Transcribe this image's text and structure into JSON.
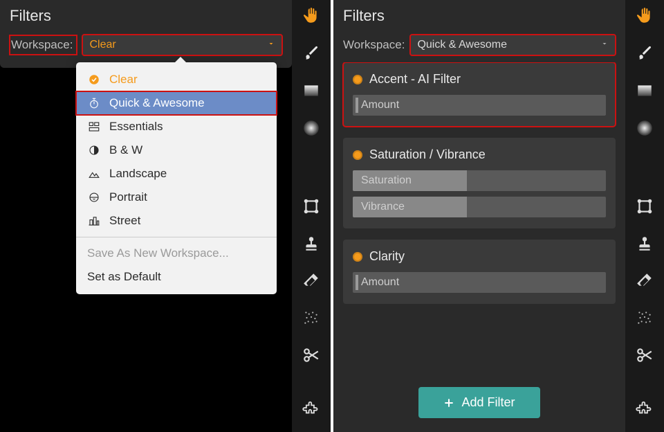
{
  "left": {
    "title": "Filters",
    "workspace_label": "Workspace:",
    "selected_workspace": "Clear",
    "dropdown": {
      "items": [
        {
          "label": "Clear"
        },
        {
          "label": "Quick & Awesome"
        },
        {
          "label": "Essentials"
        },
        {
          "label": "B & W"
        },
        {
          "label": "Landscape"
        },
        {
          "label": "Portrait"
        },
        {
          "label": "Street"
        }
      ],
      "save": "Save As New Workspace...",
      "set_default": "Set as Default"
    }
  },
  "right": {
    "title": "Filters",
    "workspace_label": "Workspace:",
    "selected_workspace": "Quick & Awesome",
    "filters": [
      {
        "name": "Accent - AI Filter",
        "sliders": [
          {
            "label": "Amount"
          }
        ]
      },
      {
        "name": "Saturation / Vibrance",
        "sliders": [
          {
            "label": "Saturation"
          },
          {
            "label": "Vibrance"
          }
        ]
      },
      {
        "name": "Clarity",
        "sliders": [
          {
            "label": "Amount"
          }
        ]
      }
    ],
    "add_filter": "Add Filter"
  }
}
